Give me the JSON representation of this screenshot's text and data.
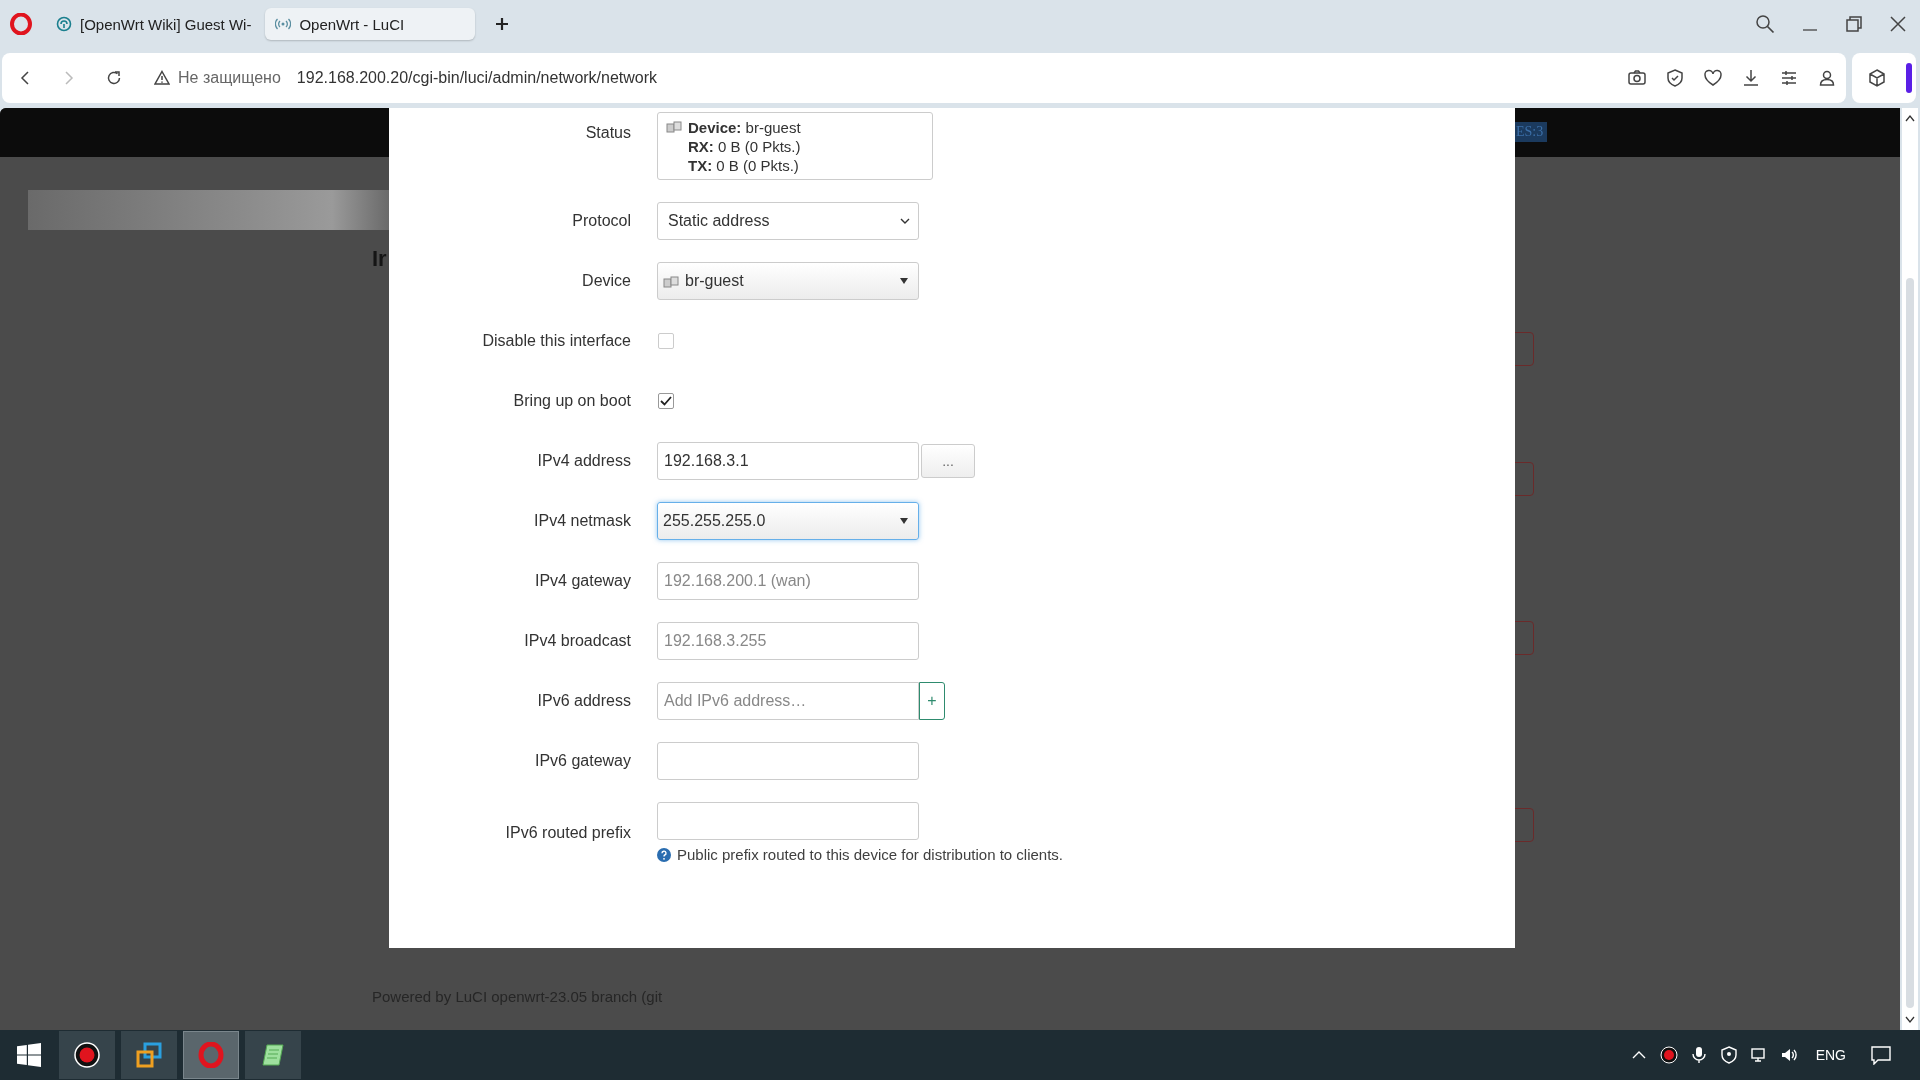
{
  "browser": {
    "tabs": [
      {
        "title": "[OpenWrt Wiki] Guest Wi-",
        "kind": "wiki",
        "selected": false
      },
      {
        "title": "OpenWrt - LuCI",
        "kind": "signal",
        "selected": true
      }
    ],
    "address_bar": {
      "security": "Не защищено",
      "url": "192.168.200.20/cgi-bin/luci/admin/network/network"
    }
  },
  "page": {
    "header_badge": "ES:3",
    "heading": "Ir",
    "footer": "Powered by LuCI openwrt-23.05 branch (git"
  },
  "dialog": {
    "rows": [
      {
        "kind": "status",
        "label": "Status",
        "lines": [
          "**Device:** br-guest",
          "**RX:** 0 B (0 Pkts.)",
          "**TX:** 0 B (0 Pkts.)"
        ]
      },
      {
        "kind": "select",
        "label": "Protocol",
        "value": "Static address"
      },
      {
        "kind": "device",
        "label": "Device",
        "value": "br-guest"
      },
      {
        "kind": "checkbox",
        "label": "Disable this interface",
        "checked": false
      },
      {
        "kind": "checkbox",
        "label": "Bring up on boot",
        "checked": true
      },
      {
        "kind": "input",
        "label": "IPv4 address",
        "value": "192.168.3.1",
        "button": "..."
      },
      {
        "kind": "combo",
        "label": "IPv4 netmask",
        "value": "255.255.255.0",
        "focused": true
      },
      {
        "kind": "input",
        "label": "IPv4 gateway",
        "placeholder": "192.168.200.1 (wan)"
      },
      {
        "kind": "input",
        "label": "IPv4 broadcast",
        "placeholder": "192.168.3.255"
      },
      {
        "kind": "dynlist",
        "label": "IPv6 address",
        "placeholder": "Add IPv6 address…",
        "button": "+"
      },
      {
        "kind": "input",
        "label": "IPv6 gateway"
      },
      {
        "kind": "input",
        "label": "IPv6 routed prefix",
        "hint": "Public prefix routed to this device for distribution to clients."
      }
    ]
  },
  "taskbar": {
    "apps": [
      {
        "kind": "record",
        "selected": false
      },
      {
        "kind": "windows-stack",
        "selected": false
      },
      {
        "kind": "opera",
        "selected": true
      },
      {
        "kind": "notepad",
        "selected": false
      }
    ],
    "language": "ENG"
  }
}
